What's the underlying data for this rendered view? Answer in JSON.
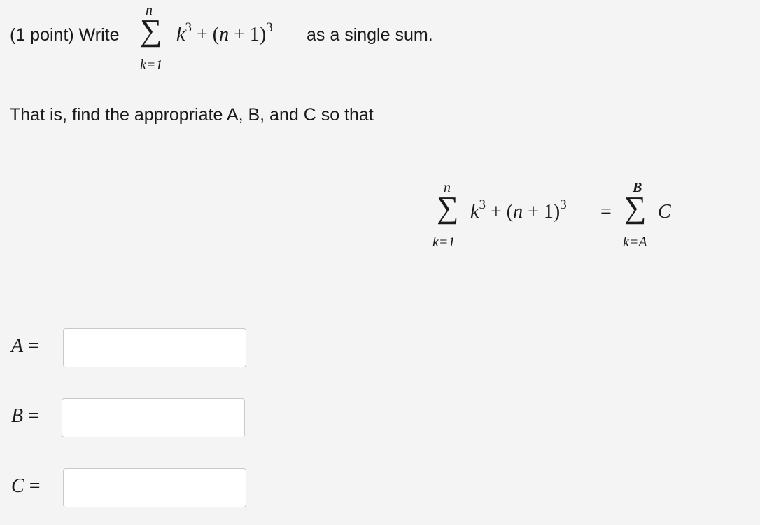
{
  "problem": {
    "prefix": "(1 point) Write",
    "sum_upper": "n",
    "sum_lower": "k=1",
    "sigma": "∑",
    "term_k": "k",
    "exponent": "3",
    "term_mid": "+ (n + 1)",
    "suffix": "as a single sum."
  },
  "instruction": "That is, find the appropriate A, B, and C so that",
  "display_equation": {
    "lhs_upper": "n",
    "lhs_lower": "k=1",
    "sigma": "∑",
    "lhs_term_k": "k",
    "exponent": "3",
    "lhs_term_mid": "+ (n + 1)",
    "equals": "=",
    "rhs_upper": "B",
    "rhs_lower": "k=A",
    "rhs_term": "C"
  },
  "answers": [
    {
      "label": "A =",
      "value": "",
      "placeholder": ""
    },
    {
      "label": "B =",
      "value": "",
      "placeholder": ""
    },
    {
      "label": "C =",
      "value": "",
      "placeholder": ""
    }
  ]
}
